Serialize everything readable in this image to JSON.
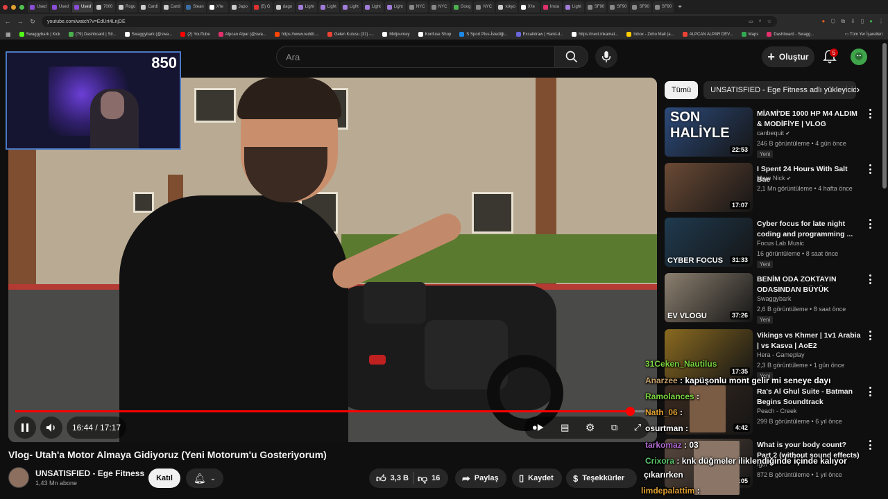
{
  "browser": {
    "tabs": [
      {
        "label": "Used",
        "color": "#8a4dd6"
      },
      {
        "label": "Used",
        "color": "#8a4dd6"
      },
      {
        "label": "Used",
        "color": "#8a4dd6"
      },
      {
        "label": "7000",
        "color": "#cccccc"
      },
      {
        "label": "Rogu",
        "color": "#cccccc"
      },
      {
        "label": "Cardi",
        "color": "#cccccc"
      },
      {
        "label": "Cardi",
        "color": "#cccccc"
      },
      {
        "label": "Stean",
        "color": "#3a6ea5"
      },
      {
        "label": "X'te",
        "color": "#ffffff"
      },
      {
        "label": "Japo",
        "color": "#cccccc"
      },
      {
        "label": "(5) G",
        "color": "#e03030"
      },
      {
        "label": "dago",
        "color": "#cccccc"
      },
      {
        "label": "Light",
        "color": "#a07cd8"
      },
      {
        "label": "Light",
        "color": "#a07cd8"
      },
      {
        "label": "Light",
        "color": "#a07cd8"
      },
      {
        "label": "Light",
        "color": "#a07cd8"
      },
      {
        "label": "Light",
        "color": "#a07cd8"
      },
      {
        "label": "NYC",
        "color": "#888888"
      },
      {
        "label": "NYC",
        "color": "#888888"
      },
      {
        "label": "Goog",
        "color": "#4caf50"
      },
      {
        "label": "NYC",
        "color": "#888888"
      },
      {
        "label": "tokyo",
        "color": "#cccccc"
      },
      {
        "label": "X'te",
        "color": "#ffffff"
      },
      {
        "label": "Insta",
        "color": "#e1306c"
      },
      {
        "label": "Light",
        "color": "#a07cd8"
      },
      {
        "label": "SF90",
        "color": "#888888"
      },
      {
        "label": "SF90",
        "color": "#888888"
      },
      {
        "label": "SF90",
        "color": "#888888"
      },
      {
        "label": "SF90",
        "color": "#888888"
      }
    ],
    "new_tab": "+",
    "url": "youtube.com/watch?v=EdUrt4LnjDE",
    "bookmarks": [
      {
        "label": "Swaggybark | Kick",
        "color": "#53fc18"
      },
      {
        "label": "(79) Dashboard | Str...",
        "color": "#4caf50"
      },
      {
        "label": "Swaggybark (@swa...",
        "color": "#ffffff"
      },
      {
        "label": "(2) YouTube",
        "color": "#ff0000"
      },
      {
        "label": "Alpcan Alpar (@swa...",
        "color": "#e1306c"
      },
      {
        "label": "https://www.reddit....",
        "color": "#ff4500"
      },
      {
        "label": "Gelen Kutusu (31) -...",
        "color": "#ea4335"
      },
      {
        "label": "Midjourney",
        "color": "#ffffff"
      },
      {
        "label": "Konfuse Shop",
        "color": "#ffffff"
      },
      {
        "label": "S Sport Plus-İstediği...",
        "color": "#1e88e5"
      },
      {
        "label": "Excalidraw | Hand-d...",
        "color": "#6965db"
      },
      {
        "label": "https://next.inkamat...",
        "color": "#ffffff"
      },
      {
        "label": "Inbox - Zoho Mail (a...",
        "color": "#ffcc00"
      },
      {
        "label": "ALPCAN ALPAR DEV...",
        "color": "#ea4335"
      },
      {
        "label": "Maps",
        "color": "#34a853"
      },
      {
        "label": "Dashboard - Swagg...",
        "color": "#e1306c"
      }
    ],
    "bookmarks_all": "Tüm Yer İşaretleri"
  },
  "header": {
    "search_placeholder": "Ara",
    "create_label": "Oluştur",
    "notif_count": "5"
  },
  "webcam": {
    "counter": "850"
  },
  "player": {
    "time": "16:44 / 17:17",
    "progress": 0.968,
    "accent": "#ff0000"
  },
  "video": {
    "title": "Vlog- Utah'a Motor Almaya Gidiyoruz (Yeni Motorum'u Gosteriyorum)",
    "channel": "UNSATISFIED - Ege Fitness",
    "subscribers": "1,43 Mn abone",
    "join": "Katıl",
    "likes": "3,3 B",
    "dislikes": "16",
    "share": "Paylaş",
    "save": "Kaydet",
    "thanks": "Teşekkürler"
  },
  "chips": {
    "all": "Tümü",
    "from_channel": "UNSATISFIED - Ege Fitness adlı yükleyiciden"
  },
  "recommendations": [
    {
      "title": "MİAMİ'DE 1000 HP M4 ALDIM & MODİFİYE | VLOG",
      "channel": "canbequit",
      "verified": true,
      "meta": "246 B görüntüleme • 4 gün önce",
      "new": "Yeni",
      "duration": "22:53",
      "thumb_text": "SON HALİYLE",
      "color": "#2c4a7a"
    },
    {
      "title": "I Spent 24 Hours With Salt Bae",
      "channel": "More Nick",
      "verified": true,
      "meta": "2,1 Mn görüntüleme • 4 hafta önce",
      "new": "",
      "duration": "17:07",
      "thumb_text": "",
      "color": "#6b4a35"
    },
    {
      "title": "Cyber focus for late night coding and programming ...",
      "channel": "Focus Lab Music",
      "verified": false,
      "meta": "16 görüntüleme • 8 saat önce",
      "new": "Yeni",
      "duration": "31:33",
      "thumb_text": "CYBER FOCUS",
      "color": "#1f3a4f"
    },
    {
      "title": "BENİM ODA ZOKTAYIN ODASINDAN BÜYÜK",
      "channel": "Swaggybark",
      "verified": false,
      "meta": "2,6 B görüntüleme • 8 saat önce",
      "new": "Yeni",
      "duration": "37:26",
      "thumb_text": "EV VLOGU",
      "color": "#8c8070"
    },
    {
      "title": "Vikings vs Khmer | 1v1 Arabia | vs Kasva | AoE2",
      "channel": "Hera - Gameplay",
      "verified": false,
      "meta": "2,3 B görüntüleme • 1 gün önce",
      "new": "Yeni",
      "duration": "17:35",
      "thumb_text": "",
      "color": "#8a6a20"
    },
    {
      "title": "Ra's Al Ghul Suite - Batman Begins Soundtrack",
      "channel": "Peach - Creek",
      "verified": false,
      "meta": "299 B görüntüleme • 6 yıl önce",
      "new": "",
      "duration": "4:42",
      "thumb_text": "",
      "color": "#3a2a20"
    },
    {
      "title": "What is your body count? Part 2 (without sound effects)",
      "channel": "Igor V",
      "verified": false,
      "meta": "872 B görüntüleme • 1 yıl önce",
      "new": "",
      "duration": "12:05",
      "thumb_text": "",
      "color": "#5a4a40"
    }
  ],
  "chat": [
    {
      "user": "31Ceken_Nautilus",
      "text": "",
      "color": "#7cd640"
    },
    {
      "user": "Anarzee",
      "text": ": kapüşonlu mont gelir mi seneye dayı",
      "color": "#c8a26a"
    },
    {
      "user": "Ramolances",
      "text": ":",
      "color": "#7cd640"
    },
    {
      "user": "Nath_06",
      "text": ":",
      "color": "#e0a030"
    },
    {
      "user": "osurtman",
      "text": ":",
      "color": "#ffffff"
    },
    {
      "user": "tarkomaz",
      "text": ": 03",
      "color": "#b06ad0"
    },
    {
      "user": "Crixora",
      "text": ": knk düğmeler iliklendiğinde içinde kalıyor",
      "color": "#59c46a"
    },
    {
      "user": "",
      "text": "çıkarırken",
      "color": "#ffffff"
    },
    {
      "user": "limdepalattim",
      "text": ":",
      "color": "#e0a030"
    }
  ]
}
